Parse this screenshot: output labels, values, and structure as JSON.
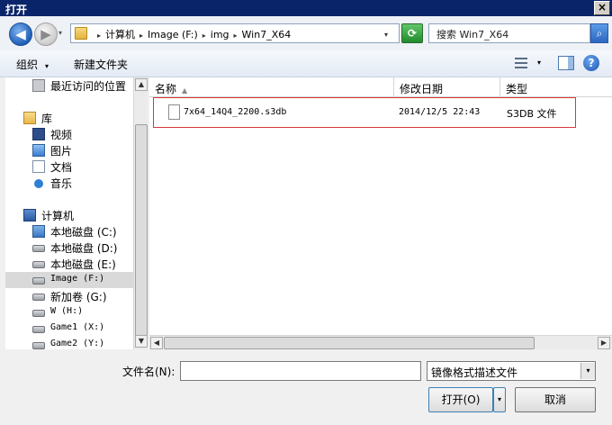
{
  "window": {
    "title": "打开",
    "close_glyph": "×"
  },
  "nav": {
    "back_glyph": "◀",
    "forward_glyph": "▶",
    "history_glyph": "▾"
  },
  "address": {
    "crumbs": [
      "计算机",
      "Image (F:)",
      "img",
      "Win7_X64"
    ],
    "separator": "▸",
    "dropdown_glyph": "▾",
    "refresh_glyph": "⟳"
  },
  "search": {
    "text": "搜索 Win7_X64",
    "icon_glyph": "⌕"
  },
  "toolbar": {
    "organize_label": "组织",
    "organize_arrow": "▾",
    "new_folder_label": "新建文件夹",
    "view_arrow": "▾",
    "help_glyph": "?"
  },
  "sidebar": {
    "items": [
      {
        "label": "最近访问的位置",
        "icon": "recent-places-icon"
      },
      {
        "label": "库",
        "icon": "library-icon"
      },
      {
        "label": "视频",
        "icon": "video-icon"
      },
      {
        "label": "图片",
        "icon": "picture-icon"
      },
      {
        "label": "文档",
        "icon": "document-icon"
      },
      {
        "label": "音乐",
        "icon": "music-icon"
      },
      {
        "label": "计算机",
        "icon": "computer-icon"
      },
      {
        "label": "本地磁盘 (C:)",
        "icon": "system-drive-icon"
      },
      {
        "label": "本地磁盘 (D:)",
        "icon": "drive-icon"
      },
      {
        "label": "本地磁盘 (E:)",
        "icon": "drive-icon"
      },
      {
        "label": "Image (F:)",
        "icon": "drive-icon",
        "selected": true
      },
      {
        "label": "新加卷 (G:)",
        "icon": "drive-icon"
      },
      {
        "label": "W (H:)",
        "icon": "drive-icon"
      },
      {
        "label": "Game1 (X:)",
        "icon": "drive-icon"
      },
      {
        "label": "Game2 (Y:)",
        "icon": "drive-icon"
      }
    ]
  },
  "scroll": {
    "up": "▲",
    "down": "▼",
    "left": "◀",
    "right": "▶"
  },
  "file_list": {
    "columns": {
      "name": "名称",
      "date": "修改日期",
      "type": "类型",
      "sort_glyph": "▲"
    },
    "rows": [
      {
        "name": "7x64_14Q4_2200.s3db",
        "date": "2014/12/5 22:43",
        "type": "S3DB 文件"
      }
    ]
  },
  "bottom": {
    "filename_label": "文件名(N):",
    "filename_value": "",
    "filetype_value": "镜像格式描述文件",
    "filetype_drop": "▾",
    "open_label": "打开(O)",
    "open_drop": "▾",
    "cancel_label": "取消"
  }
}
